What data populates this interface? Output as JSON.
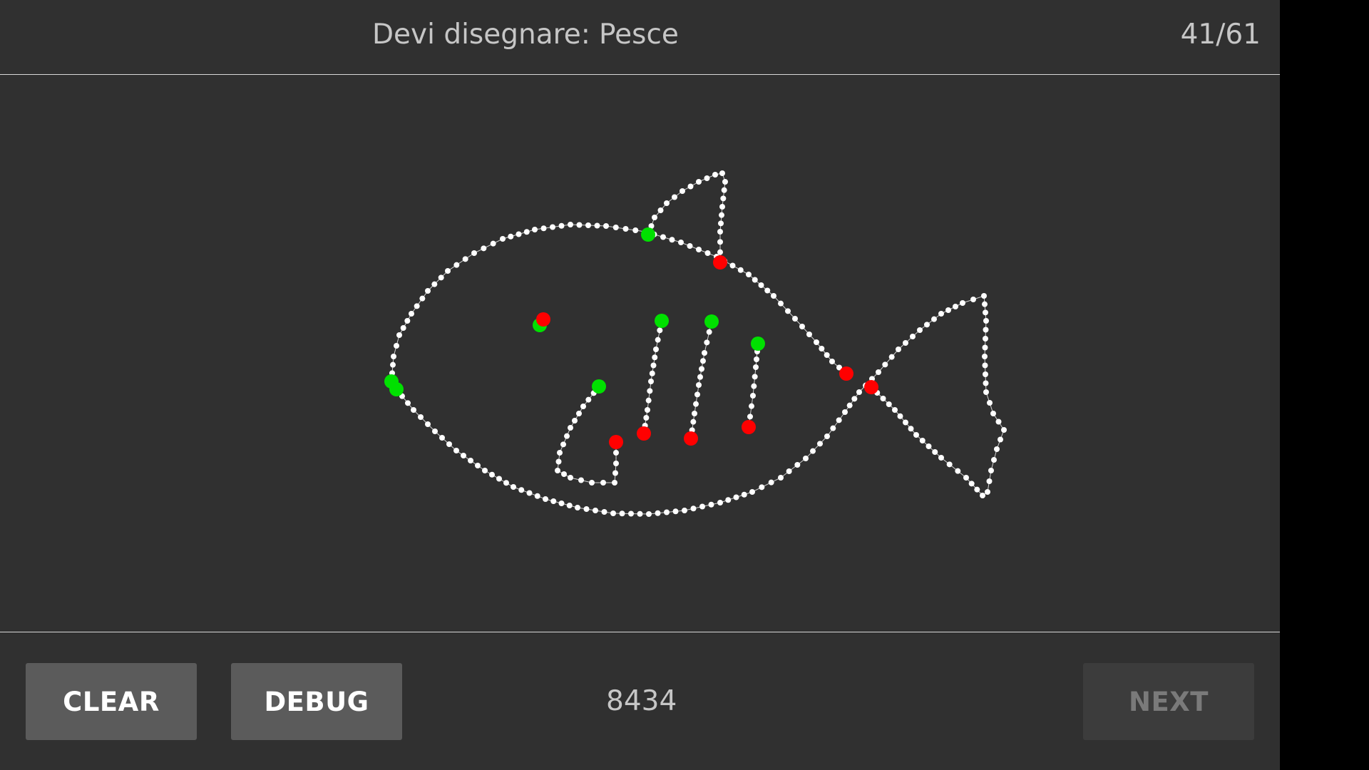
{
  "header": {
    "prompt_label": "Devi disegnare:",
    "prompt_word": "Pesce",
    "progress": "41/61"
  },
  "footer": {
    "clear_label": "CLEAR",
    "debug_label": "DEBUG",
    "score": "8434",
    "next_label": "NEXT",
    "next_enabled": false
  },
  "drawing": {
    "subject": "fish",
    "stroke_point_color": "#ffffff",
    "stroke_start_color": "#00e000",
    "stroke_end_color": "#ff0000",
    "stroke_count": 8
  },
  "colors": {
    "background": "#303030",
    "button": "#5b5b5b",
    "button_disabled": "#3c3c3c",
    "text": "#c6c6c6"
  }
}
